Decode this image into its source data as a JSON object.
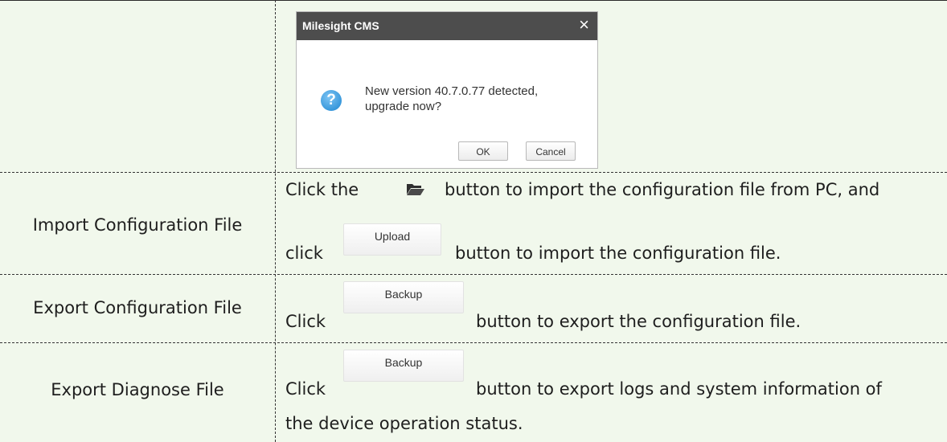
{
  "dialog": {
    "title": "Milesight CMS",
    "close_glyph": "×",
    "message_line1": "New version 40.7.0.77 detected,",
    "message_line2": "upgrade now?",
    "ok_label": "OK",
    "cancel_label": "Cancel",
    "icon": "question-icon"
  },
  "rows": {
    "import": {
      "label": "Import Configuration File",
      "line1_before": "Click the",
      "line1_after": "button to import the configuration file from PC, and",
      "line2_before": "click",
      "button_label": "Upload",
      "line2_after": "button to import the configuration file."
    },
    "export_config": {
      "label": "Export Configuration File",
      "before": "Click",
      "button_label": "Backup",
      "after": "button to export the configuration file."
    },
    "export_diagnose": {
      "label": "Export Diagnose File",
      "before": "Click",
      "button_label": "Backup",
      "after": "button to export logs and system information of",
      "line2": "the device operation status."
    }
  },
  "icons": {
    "folder": "folder-open-icon"
  },
  "colors": {
    "table_bg": "#f1f8ec",
    "dialog_title_bg": "#4d4d4d",
    "question_icon": "#1d86d1"
  }
}
